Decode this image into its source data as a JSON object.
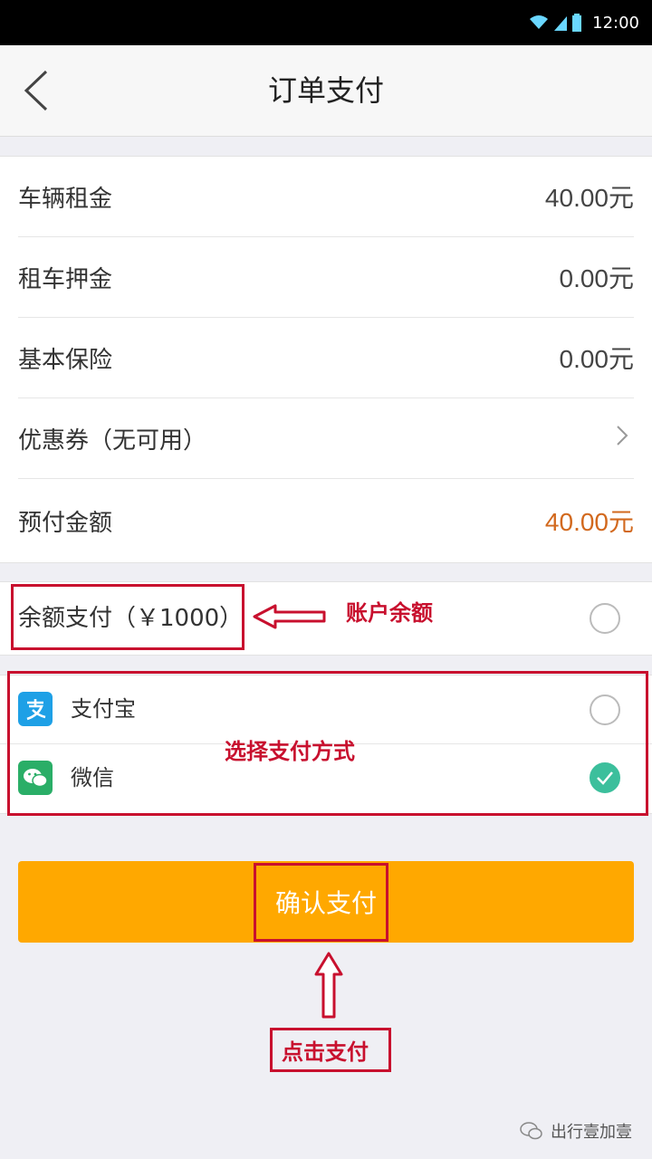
{
  "status_bar": {
    "time": "12:00"
  },
  "header": {
    "title": "订单支付"
  },
  "fees": [
    {
      "label": "车辆租金",
      "value": "40.00元"
    },
    {
      "label": "租车押金",
      "value": "0.00元"
    },
    {
      "label": "基本保险",
      "value": "0.00元"
    },
    {
      "label": "优惠券（无可用）",
      "value": ""
    },
    {
      "label": "预付金额",
      "value": "40.00元"
    }
  ],
  "balance": {
    "label": "余额支付（￥1000）",
    "selected": false
  },
  "methods": [
    {
      "label": "支付宝",
      "selected": false
    },
    {
      "label": "微信",
      "selected": true
    }
  ],
  "confirm": {
    "label": "确认支付"
  },
  "annotations": {
    "balance_note": "账户余额",
    "method_note": "选择支付方式",
    "confirm_note": "点击支付"
  },
  "colors": {
    "accent": "#ffa800",
    "highlight_amount": "#d2691e",
    "check": "#3cbf9c",
    "annotation": "#c8102e"
  },
  "watermark": {
    "text": "出行壹加壹"
  }
}
